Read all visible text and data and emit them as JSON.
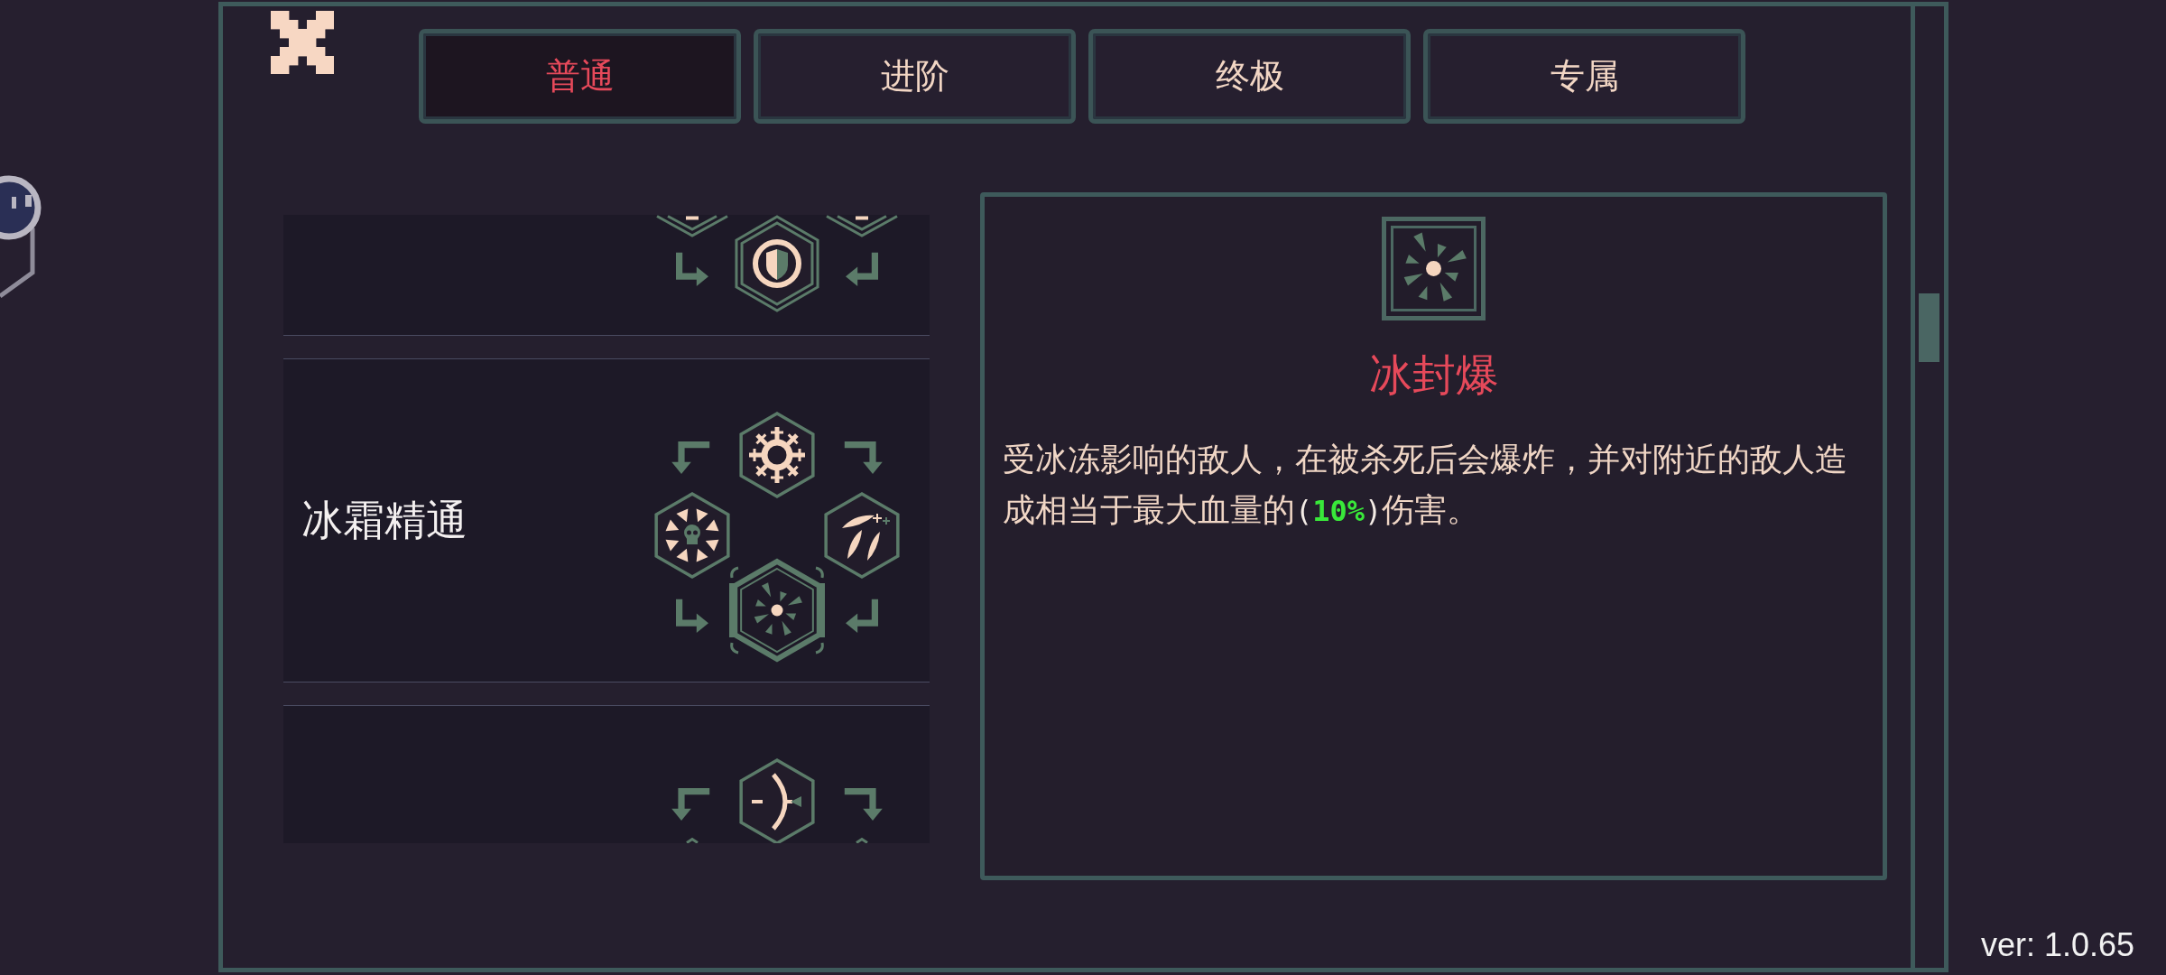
{
  "tabs": [
    {
      "label": "普通",
      "selected": true
    },
    {
      "label": "进阶",
      "selected": false
    },
    {
      "label": "终极",
      "selected": false
    },
    {
      "label": "专属",
      "selected": false
    }
  ],
  "skill_rows": [
    {
      "clipped_top": true,
      "clipped_bottom": false,
      "nodes": {
        "bottom": {
          "kind": "shield",
          "double_frame": true,
          "selected": false
        }
      }
    },
    {
      "title": "冰霜精通",
      "clipped_top": false,
      "clipped_bottom": false,
      "nodes": {
        "top": {
          "kind": "snowflake",
          "double_frame": false,
          "selected": false
        },
        "left": {
          "kind": "skull",
          "double_frame": false,
          "selected": false
        },
        "right": {
          "kind": "leaves",
          "double_frame": false,
          "selected": false
        },
        "bottom": {
          "kind": "shards",
          "double_frame": false,
          "selected": true
        }
      }
    },
    {
      "clipped_top": false,
      "clipped_bottom": true,
      "nodes": {
        "top": {
          "kind": "bow",
          "double_frame": false,
          "selected": false
        }
      }
    }
  ],
  "detail": {
    "title": "冰封爆",
    "description": [
      {
        "kind": "text",
        "text": "受冰冻影响的敌人，在被杀死后会爆炸，并对附近的敌人造成相当于最大血量的"
      },
      {
        "kind": "bracket",
        "text": "("
      },
      {
        "kind": "value",
        "text": "10%"
      },
      {
        "kind": "bracket",
        "text": ")"
      },
      {
        "kind": "text",
        "text": "伤害。"
      }
    ]
  },
  "version": "ver: 1.0.65"
}
